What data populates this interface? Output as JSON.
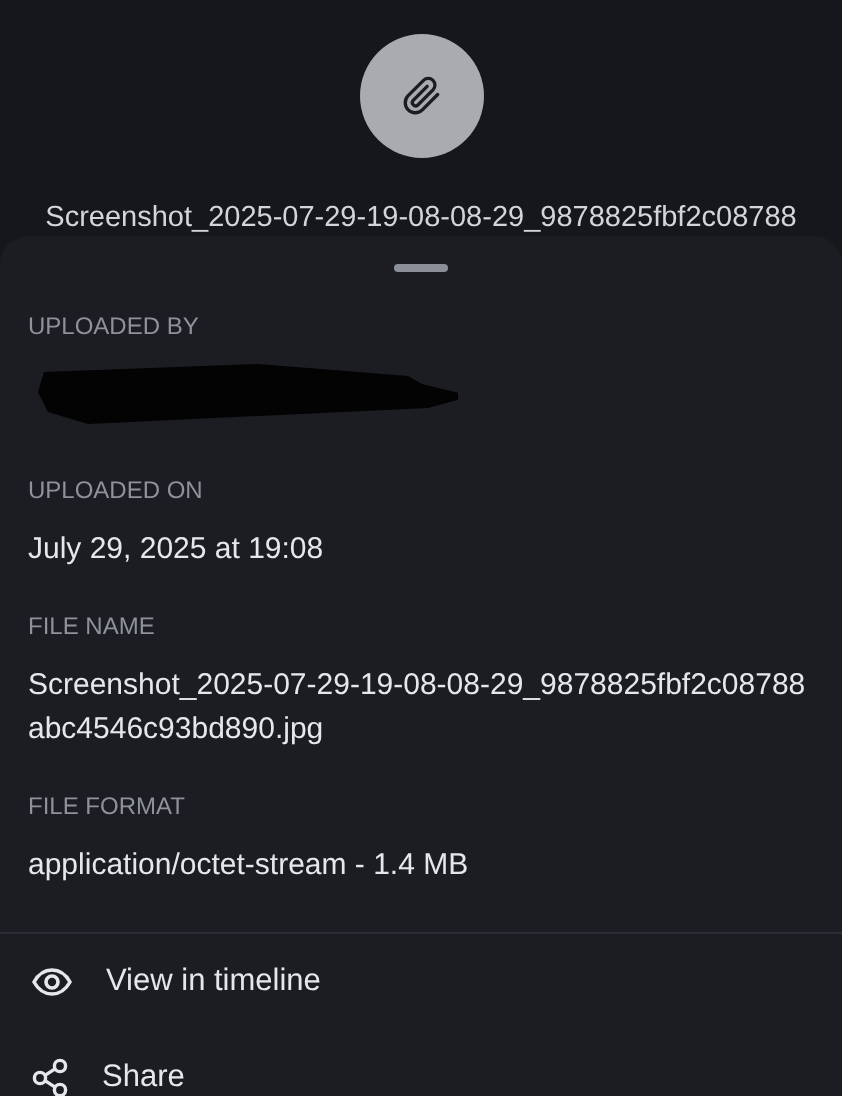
{
  "header": {
    "title": "Screenshot_2025-07-29-19-08-08-29_9878825fbf2c08788"
  },
  "details": [
    {
      "kind": "redacted",
      "label": "UPLOADED BY"
    },
    {
      "kind": "text",
      "label": "UPLOADED ON",
      "value": "July 29, 2025 at 19:08"
    },
    {
      "kind": "text",
      "label": "FILE NAME",
      "value": "Screenshot_2025-07-29-19-08-08-29_9878825fbf2c08788abc4546c93bd890.jpg"
    },
    {
      "kind": "text",
      "label": "FILE FORMAT",
      "value": "application/octet-stream - 1.4 MB"
    }
  ],
  "actions": [
    {
      "kind": "view",
      "label": "View in timeline"
    },
    {
      "kind": "share",
      "label": "Share"
    }
  ]
}
